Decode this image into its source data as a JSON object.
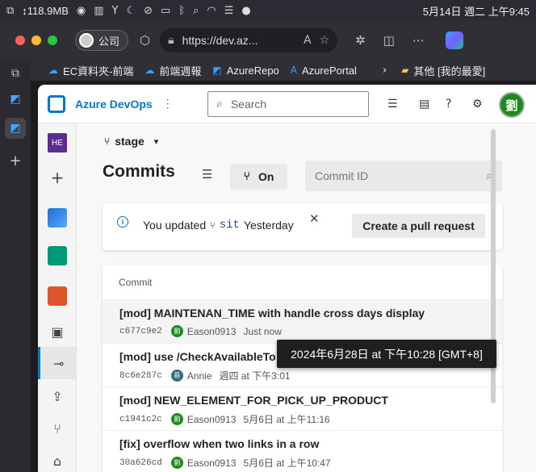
{
  "menubar": {
    "net": "↕118.9MB",
    "date_time": "5月14日 週二 上午9:45"
  },
  "browser": {
    "profile": "公司",
    "url": "https://dev.az...",
    "favorites": [
      {
        "label": "EC資料夾-前端",
        "icon": "cloud-icon"
      },
      {
        "label": "前端週報",
        "icon": "cloud-icon"
      },
      {
        "label": "AzureRepo",
        "icon": "azure-devops-icon"
      },
      {
        "label": "AzurePortal",
        "icon": "azure-icon"
      }
    ],
    "other_favorites": "其他 [我的最愛]"
  },
  "app": {
    "brand": "Azure DevOps",
    "search_placeholder": "Search",
    "user_initial": "劉",
    "project_badge": "HE"
  },
  "page": {
    "branch": "stage",
    "title": "Commits",
    "toggle_label": "On",
    "commit_id_placeholder": "Commit ID"
  },
  "banner": {
    "prefix": "You updated",
    "branch": "sit",
    "when": "Yesterday",
    "button": "Create a pull request"
  },
  "commits": {
    "header": "Commit",
    "rows": [
      {
        "message": "[mod] MAINTENAN_TIME with handle cross days display",
        "hash": "c677c9e2",
        "avatar": "劉",
        "author": "Eason0913",
        "time": "Just now"
      },
      {
        "message": "[mod] use /CheckAvailableTo",
        "hash": "8c6e287c",
        "avatar": "蔡",
        "author": "Annie",
        "time": "週四 at 下午3:01"
      },
      {
        "message": "[mod] NEW_ELEMENT_FOR_PICK_UP_PRODUCT",
        "hash": "c1941c2c",
        "avatar": "劉",
        "author": "Eason0913",
        "time": "5月6日 at 上午11:16"
      },
      {
        "message": "[fix] overflow when two links in a row",
        "hash": "30a626cd",
        "avatar": "劉",
        "author": "Eason0913",
        "time": "5月6日 at 上午10:47"
      }
    ]
  },
  "tooltip": "2024年6月28日 at 下午10:28 [GMT+8]",
  "colors": {
    "accent": "#0078d4",
    "avatar_green": "#1e8a1e",
    "project_purple": "#5c2d91"
  }
}
